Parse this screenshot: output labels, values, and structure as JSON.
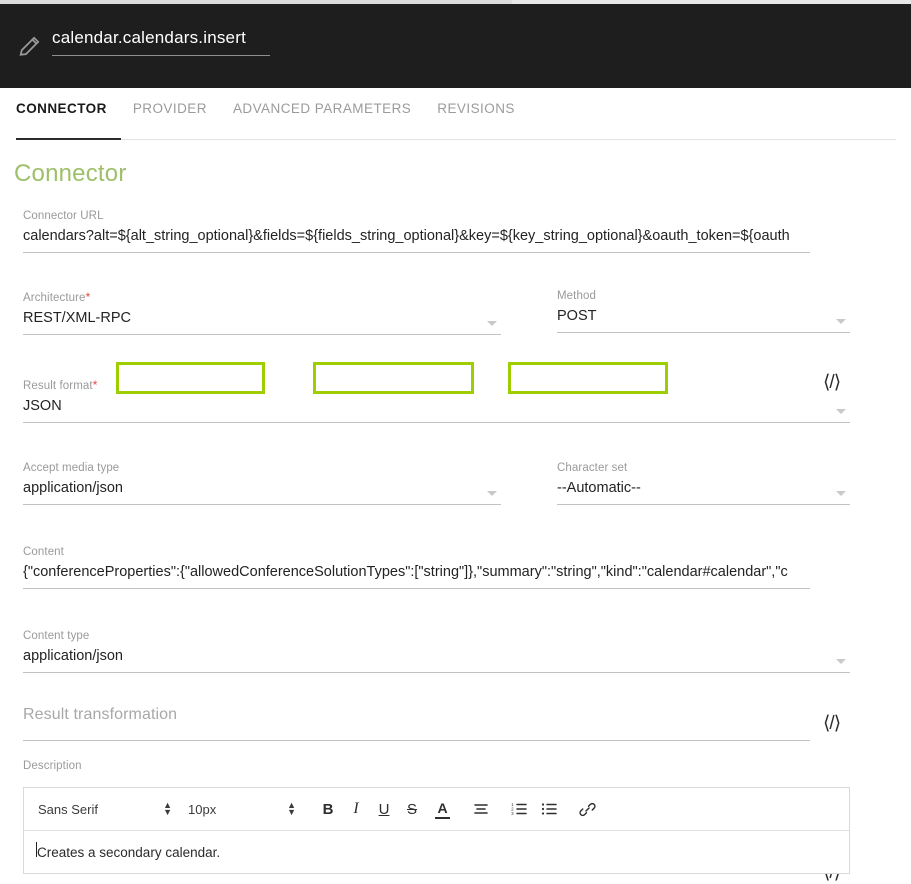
{
  "header": {
    "icon": "pencil-icon",
    "title": "calendar.calendars.insert"
  },
  "tabs": [
    {
      "label": "CONNECTOR",
      "active": true
    },
    {
      "label": "PROVIDER",
      "active": false
    },
    {
      "label": "ADVANCED PARAMETERS",
      "active": false
    },
    {
      "label": "REVISIONS",
      "active": false
    }
  ],
  "section": {
    "title": "Connector"
  },
  "colors": {
    "accent_green": "#9ec06a",
    "highlight_green": "#9ecd00",
    "required_red": "#e8453c",
    "header_bg": "#1e1e1e"
  },
  "fields": {
    "connector_url": {
      "label": "Connector URL",
      "value": "calendars?alt=${alt_string_optional}&fields=${fields_string_optional}&key=${key_string_optional}&oauth_token=${oauth",
      "code_icon": "code-icon",
      "highlights": [
        "${alt_string_optional}",
        "${fields_string_optional}",
        "${key_string_optional}"
      ]
    },
    "architecture": {
      "label": "Architecture",
      "required": "*",
      "value": "REST/XML-RPC"
    },
    "method": {
      "label": "Method",
      "value": "POST"
    },
    "result_format": {
      "label": "Result format",
      "required": "*",
      "value": "JSON"
    },
    "accept_media_type": {
      "label": "Accept media type",
      "value": "application/json"
    },
    "character_set": {
      "label": "Character set",
      "value": "--Automatic--"
    },
    "content": {
      "label": "Content",
      "value": "{\"conferenceProperties\":{\"allowedConferenceSolutionTypes\":[\"string\"]},\"summary\":\"string\",\"kind\":\"calendar#calendar\",\"c",
      "code_icon": "code-icon"
    },
    "content_type": {
      "label": "Content type",
      "value": "application/json"
    },
    "result_transformation": {
      "label": "Result transformation",
      "value": "",
      "code_icon": "code-icon"
    },
    "description": {
      "label": "Description",
      "value": "Creates a secondary calendar."
    }
  },
  "editor_toolbar": {
    "font_family": "Sans Serif",
    "font_size": "10px",
    "buttons": [
      {
        "name": "bold-button",
        "glyph": "B"
      },
      {
        "name": "italic-button",
        "glyph": "I"
      },
      {
        "name": "underline-button",
        "glyph": "U"
      },
      {
        "name": "strikethrough-button",
        "glyph": "S"
      },
      {
        "name": "text-color-button",
        "glyph": "A"
      }
    ]
  }
}
